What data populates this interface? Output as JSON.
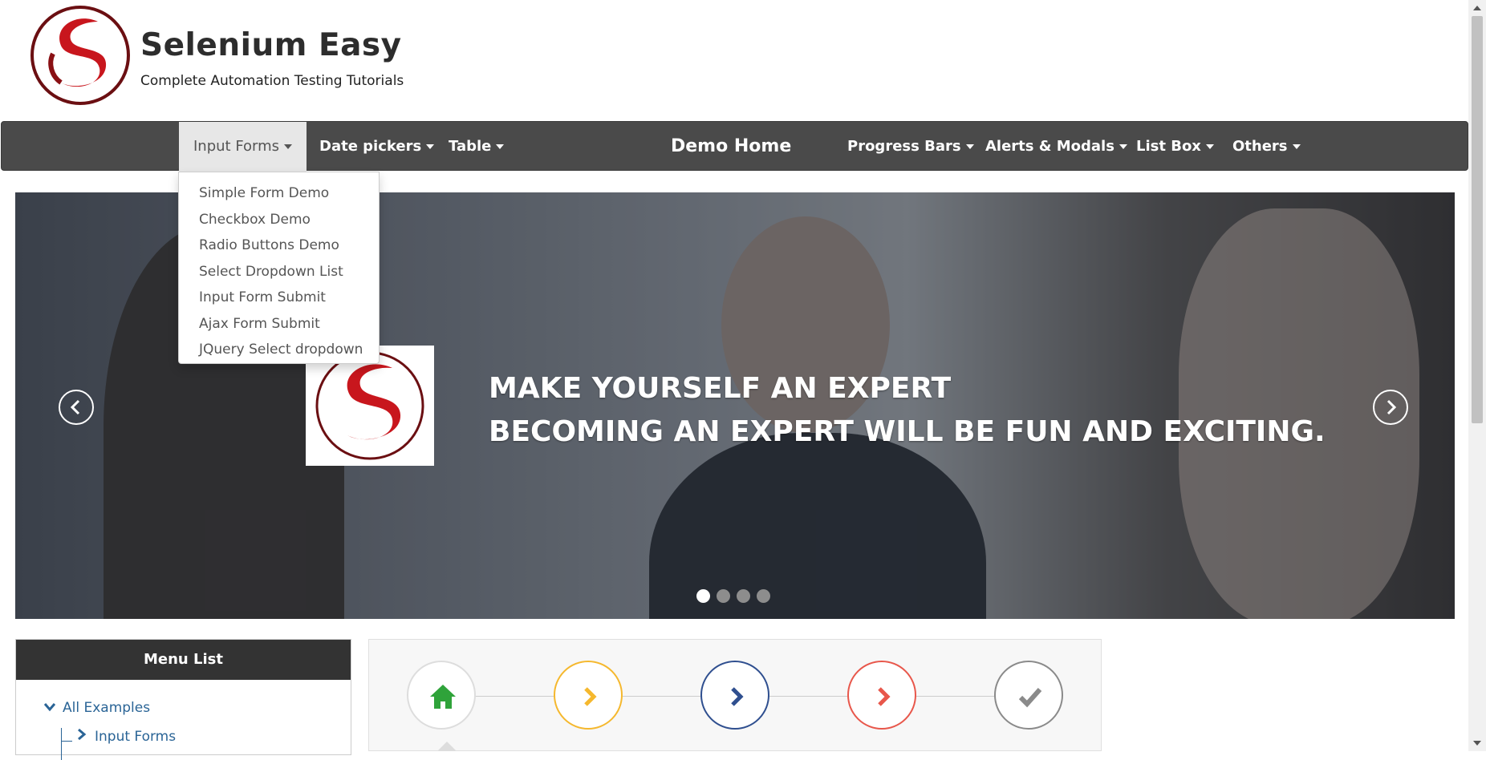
{
  "header": {
    "title": "Selenium Easy",
    "subtitle": "Complete Automation Testing Tutorials",
    "logo_icon": "selenium-easy-logo"
  },
  "nav": {
    "items": [
      {
        "label": "Input Forms"
      },
      {
        "label": "Date pickers"
      },
      {
        "label": "Table"
      },
      {
        "label": "Demo Home"
      },
      {
        "label": "Progress Bars"
      },
      {
        "label": "Alerts & Modals"
      },
      {
        "label": "List Box"
      },
      {
        "label": "Others"
      }
    ],
    "active_index": 0
  },
  "dropdown": {
    "items": [
      "Simple Form Demo",
      "Checkbox Demo",
      "Radio Buttons Demo",
      "Select Dropdown List",
      "Input Form Submit",
      "Ajax Form Submit",
      "JQuery Select dropdown"
    ]
  },
  "carousel": {
    "caption_line1": "MAKE YOURSELF AN EXPERT",
    "caption_line2": "BECOMING AN EXPERT WILL BE FUN AND EXCITING.",
    "slide_count": 4,
    "active_slide": 1
  },
  "menu_list": {
    "title": "Menu List",
    "root": "All Examples",
    "child": "Input Forms"
  },
  "steps": [
    {
      "icon": "home-icon",
      "color": "#2fa33a"
    },
    {
      "icon": "chevron-right-icon",
      "color": "#f5b82e"
    },
    {
      "icon": "chevron-right-icon",
      "color": "#2f4f8f"
    },
    {
      "icon": "chevron-right-icon",
      "color": "#e8574b"
    },
    {
      "icon": "check-icon",
      "color": "#8a8a8a"
    }
  ],
  "colors": {
    "navbar": "#4a4a4a",
    "link": "#2a6496",
    "brand_red": "#c8161d"
  }
}
